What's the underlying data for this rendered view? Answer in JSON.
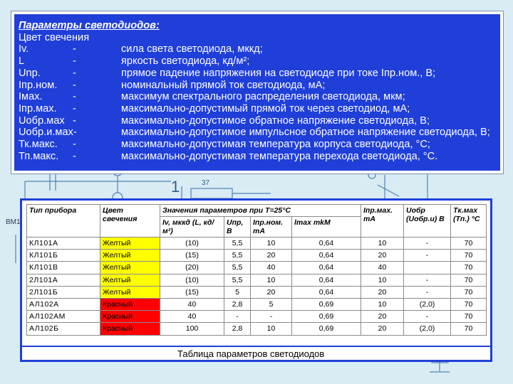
{
  "params": {
    "title": "Параметры светодиодов:",
    "subtitle": "Цвет свечения",
    "rows": [
      {
        "symbol": "Iv.",
        "dash": "-",
        "desc": "сила света светодиода, мккд;"
      },
      {
        "symbol": "L",
        "dash": "-",
        "desc": "яркость светодиода, кд/м²;"
      },
      {
        "symbol": "Unp.",
        "dash": "-",
        "desc": "прямое падение напряжения на светодиоде при токе Iпр.ном., В;"
      },
      {
        "symbol": "Iпр.ном.",
        "dash": "-",
        "desc": "номинальный прямой ток светодиода, мА;"
      },
      {
        "symbol": "Iмах.",
        "dash": "-",
        "desc": "максимум спектрального распределения светодиода, мкм;"
      },
      {
        "symbol": "Iпр.мах.",
        "dash": "-",
        "desc": "максимально-допустимый прямой ток через светодиод, мА;"
      },
      {
        "symbol": "Uобр.мах",
        "dash": "-",
        "desc": "максимально-допустимое обратное напряжение светодиода, В;"
      },
      {
        "symbol": "Uобр.и.мах-",
        "dash": "",
        "desc": "максимально-допустимое импульсное обратное напряжение светодиода, В;"
      },
      {
        "symbol": "Тк.макс.",
        "dash": "-",
        "desc": "максимально-допустимая температура корпуса светодиода, °С;"
      },
      {
        "symbol": "Тп.макс.",
        "dash": "-",
        "desc": "максимально-допустимая температура перехода светодиода, °С."
      }
    ]
  },
  "table": {
    "headers": {
      "type": "Тип прибора",
      "color": "Цвет свечения",
      "group": "Значения параметров при Т=25°С",
      "iv": "Iv, мккд (L, кд/м²)",
      "u": "Uпр, В",
      "inom": "Iпр.ном. mA",
      "lmax": "lmax mkM",
      "imax": "Iпр.мах. mA",
      "uobr": "Uобр (Uобр.и) B",
      "tk": "Tк.мах (Tп.) °С"
    },
    "rows": [
      {
        "name": "КЛ101А",
        "color": "Желтый",
        "tone": "yellow",
        "iv": "(10)",
        "u": "5,5",
        "inom": "10",
        "lmax": "0,64",
        "imax": "10",
        "uobr": "-",
        "tk": "70"
      },
      {
        "name": "КЛ101Б",
        "color": "Желтый",
        "tone": "yellow",
        "iv": "(15)",
        "u": "5,5",
        "inom": "20",
        "lmax": "0,64",
        "imax": "20",
        "uobr": "-",
        "tk": "70"
      },
      {
        "name": "КЛ101В",
        "color": "Желтый",
        "tone": "yellow",
        "iv": "(20)",
        "u": "5,5",
        "inom": "40",
        "lmax": "0,64",
        "imax": "40",
        "uobr": "",
        "tk": "70"
      },
      {
        "name": "2Л101А",
        "color": "Желтый",
        "tone": "yellow",
        "iv": "(10)",
        "u": "5,5",
        "inom": "10",
        "lmax": "0,64",
        "imax": "10",
        "uobr": "-",
        "tk": "70"
      },
      {
        "name": "2Л101Б",
        "color": "Желтый",
        "tone": "yellow",
        "iv": "(15)",
        "u": "5",
        "inom": "20",
        "lmax": "0,64",
        "imax": "20",
        "uobr": "-",
        "tk": "70"
      },
      {
        "name": "АЛ102А",
        "color": "Красный",
        "tone": "red",
        "iv": "40",
        "u": "2,8",
        "inom": "5",
        "lmax": "0,69",
        "imax": "10",
        "uobr": "(2,0)",
        "tk": "70"
      },
      {
        "name": "АЛ102АМ",
        "color": "Красный",
        "tone": "red",
        "iv": "40",
        "u": "-",
        "inom": "-",
        "lmax": "0,69",
        "imax": "20",
        "uobr": "-",
        "tk": "70"
      },
      {
        "name": "АЛ102Б",
        "color": "Красный",
        "tone": "red",
        "iv": "100",
        "u": "2,8",
        "inom": "10",
        "lmax": "0,69",
        "imax": "20",
        "uobr": "(2,0)",
        "tk": "70"
      }
    ],
    "caption": "Таблица параметров светодиодов"
  },
  "background": {
    "labels": [
      "1",
      "37",
      "BM1"
    ]
  },
  "colors": {
    "panel_blue": "#1f3fd8",
    "yellow": "#ffff00",
    "red": "#ff0000",
    "page_bg": "#d9ecf4"
  }
}
